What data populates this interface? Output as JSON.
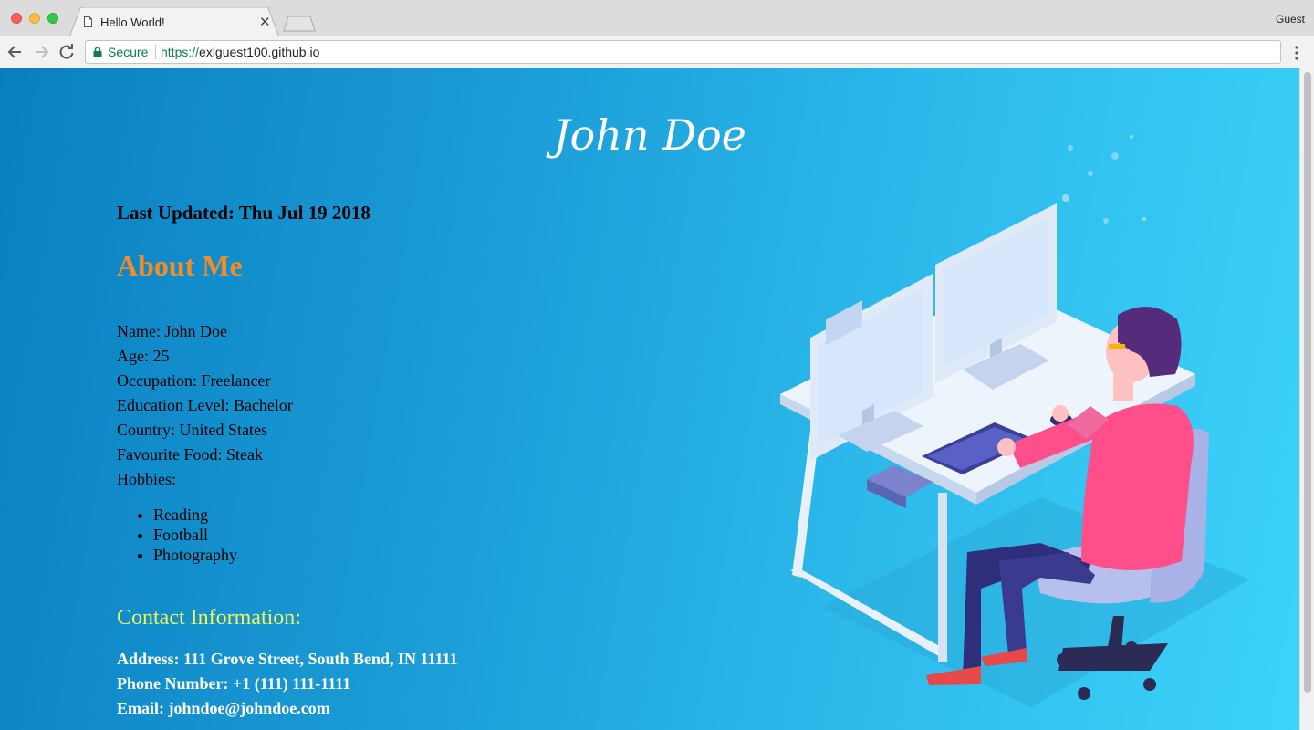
{
  "browser": {
    "tab_title": "Hello World!",
    "profile_label": "Guest",
    "secure_label": "Secure",
    "url_scheme": "https://",
    "url_host": "exlguest100.github.io"
  },
  "page": {
    "title": "John Doe",
    "last_updated": "Last Updated: Thu Jul 19 2018",
    "about_heading": "About Me",
    "info": {
      "name": "Name: John Doe",
      "age": "Age: 25",
      "occupation": "Occupation: Freelancer",
      "education": "Education Level: Bachelor",
      "country": "Country: United States",
      "food": "Favourite Food: Steak",
      "hobbies_label": "Hobbies:"
    },
    "hobbies": [
      "Reading",
      "Football",
      "Photography"
    ],
    "contact_heading": "Contact Information:",
    "contact": {
      "address": "Address: 111 Grove Street, South Bend, IN 11111",
      "phone": "Phone Number: +1 (111) 111-1111",
      "email": "Email: johndoe@johndoe.com"
    }
  },
  "colors": {
    "background_left": "#0a7fc0",
    "background_right": "#3dd3fa",
    "about_heading": "#f28c28",
    "contact_heading": "#f3f35a",
    "secure_green": "#0b8043"
  },
  "icons": [
    "page-icon",
    "tab-close-icon",
    "new-tab-icon",
    "back-arrow-icon",
    "forward-arrow-icon",
    "reload-icon",
    "lock-icon",
    "menu-dots-icon",
    "workstation-illustration"
  ]
}
